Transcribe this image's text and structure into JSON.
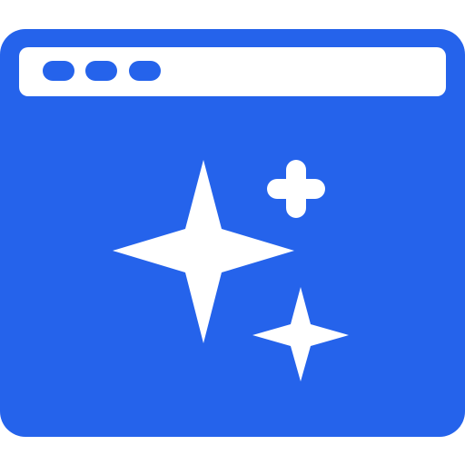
{
  "icon": {
    "name": "browser-window-sparkles-icon",
    "colors": {
      "primary": "#2563EB",
      "foreground": "#FFFFFF",
      "background": "#FFFFFF"
    },
    "parts": [
      "window-frame",
      "title-bar",
      "window-control-dot",
      "window-control-dot",
      "window-control-dot",
      "large-sparkle-icon",
      "small-sparkle-icon",
      "plus-icon"
    ]
  }
}
